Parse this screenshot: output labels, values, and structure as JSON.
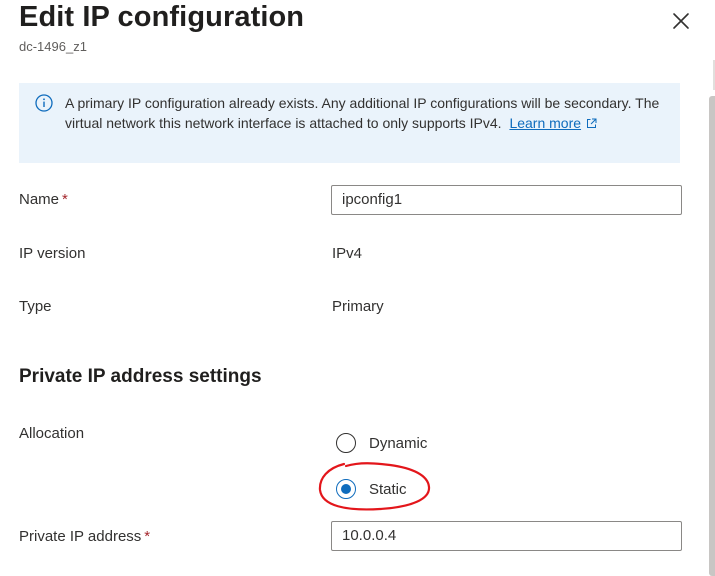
{
  "header": {
    "title": "Edit IP configuration",
    "subtitle": "dc-1496_z1",
    "close_icon": "close-icon"
  },
  "info": {
    "icon": "info-icon",
    "text": "A primary IP configuration already exists. Any additional IP configurations will be secondary. The virtual network this network interface is attached to only supports IPv4.",
    "link_label": "Learn more",
    "link_icon": "external-link-icon"
  },
  "form": {
    "name_label": "Name",
    "name_value": "ipconfig1",
    "ip_version_label": "IP version",
    "ip_version_value": "IPv4",
    "type_label": "Type",
    "type_value": "Primary",
    "required_marker": "*"
  },
  "private_ip": {
    "section_title": "Private IP address settings",
    "allocation_label": "Allocation",
    "options": [
      "Dynamic",
      "Static"
    ],
    "selected": "Static",
    "address_label": "Private IP address",
    "address_value": "10.0.0.4"
  },
  "colors": {
    "accent": "#0f6cbd",
    "info_background": "#eaf3fb",
    "required": "#a4262c",
    "annotation": "#e3161b"
  }
}
